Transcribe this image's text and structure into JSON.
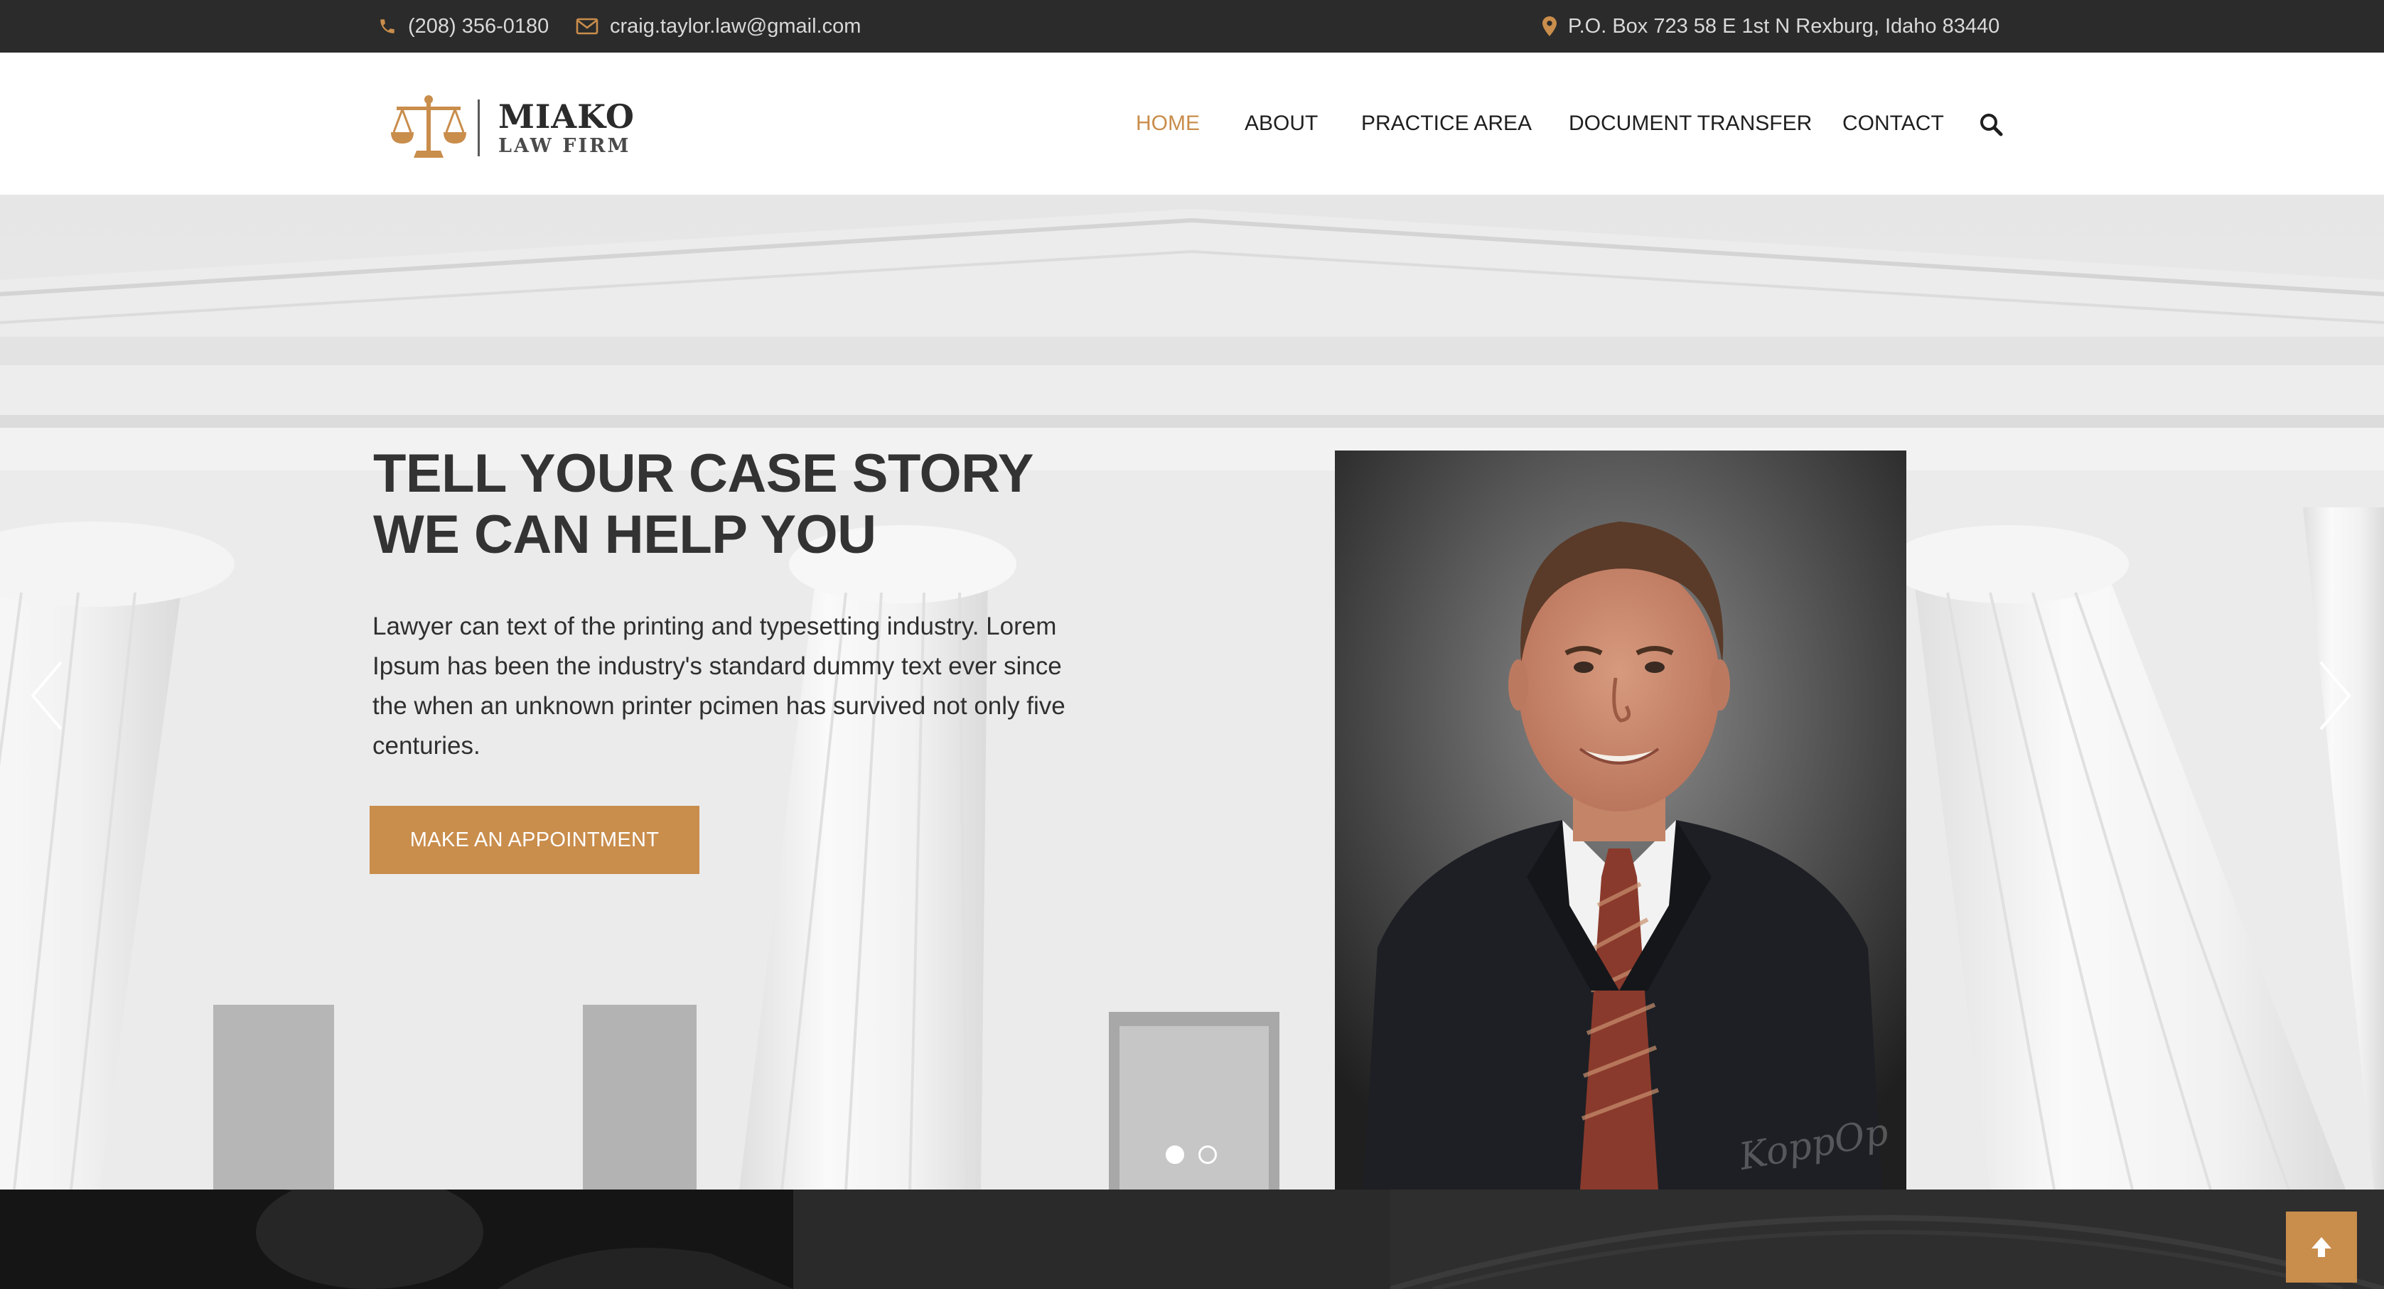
{
  "topbar": {
    "phone": "(208) 356-0180",
    "email": "craig.taylor.law@gmail.com",
    "address": "P.O. Box 723 58 E 1st N Rexburg, Idaho 83440",
    "phone_icon": "phone-icon",
    "email_icon": "envelope-icon",
    "address_icon": "map-marker-icon"
  },
  "brand": {
    "name": "MIAKO",
    "subtitle": "LAW FIRM",
    "logo_icon": "scales-of-justice-icon"
  },
  "nav": {
    "items": [
      "HOME",
      "ABOUT",
      "PRACTICE AREA",
      "DOCUMENT TRANSFER",
      "CONTACT"
    ],
    "active": "HOME",
    "search_icon": "search-icon"
  },
  "hero": {
    "title_line1": "TELL YOUR CASE STORY",
    "title_line2": "WE CAN HELP YOU",
    "text": "Lawyer can text of the printing and typesetting industry. Lorem Ipsum has been the industry's standard dummy text ever since the when an unknown printer pcimen has survived not only five centuries.",
    "button": "MAKE AN APPOINTMENT",
    "slides": 2,
    "active_slide": 1,
    "prev_icon": "chevron-left-icon",
    "next_icon": "chevron-right-icon",
    "photo_signature": "KoppOp"
  },
  "back_to_top_icon": "arrow-up-icon",
  "colors": {
    "accent": "#c98d4c",
    "topbar_bg": "#2b2b2b",
    "heading": "#333333"
  }
}
